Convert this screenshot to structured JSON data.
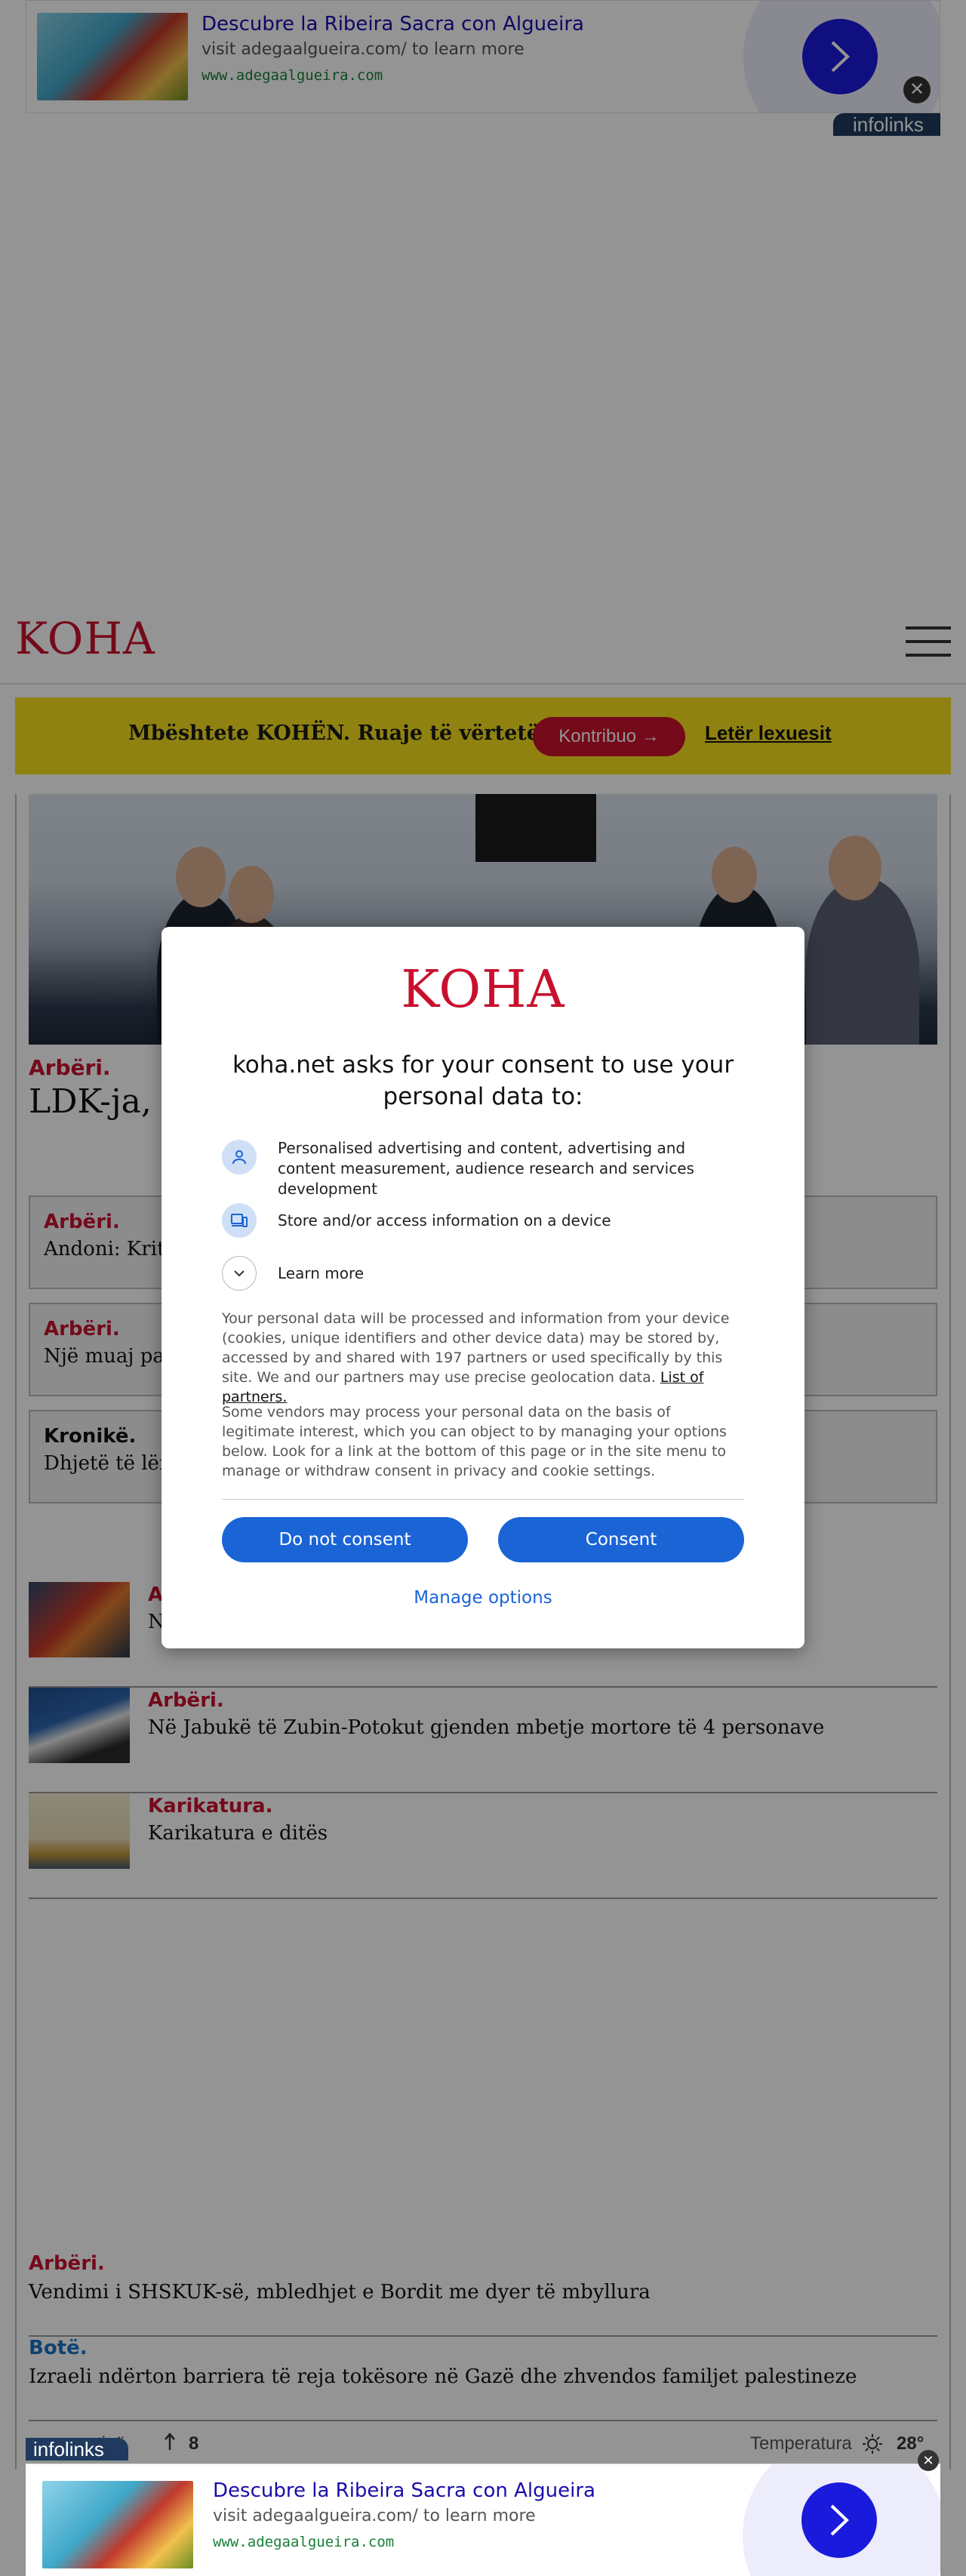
{
  "ads": {
    "top": {
      "title": "Descubre la Ribeira Sacra con Algueira",
      "line": "visit adegaalgueira.com/ to learn more",
      "url": "www.adegaalgueira.com",
      "badge": "infolinks"
    },
    "bottom": {
      "title": "Descubre la Ribeira Sacra con Algueira",
      "line": "visit adegaalgueira.com/ to learn more",
      "url": "www.adegaalgueira.com",
      "badge": "infolinks"
    },
    "close_glyph": "✕"
  },
  "header": {
    "logo": "KOHA",
    "menu_icon": "hamburger-menu-icon"
  },
  "support_bar": {
    "text": "Mbështete KOHËN. Ruaje të vërtetën",
    "button": "Kontribuo →",
    "link": "Letër lexuesit"
  },
  "lead": {
    "category": "Arbëri.",
    "headline": "LDK-ja, e"
  },
  "boxed": [
    {
      "category": "Arbëri.",
      "headline": "Andoni: Kritik"
    },
    {
      "category": "Arbëri.",
      "headline": "Një muaj para"
    },
    {
      "category": "Kronikë.",
      "headline": "Dhjetë të lënd"
    }
  ],
  "list": [
    {
      "category": "A",
      "headline": "N",
      "thumb": "fuel-pump-photo"
    },
    {
      "category": "Arbëri.",
      "headline": "Në Jabukë të Zubin-Potokut gjenden mbetje mortore të 4 personave",
      "thumb": "press-conference-photo"
    },
    {
      "category": "Karikatura.",
      "headline": "Karikatura e ditës",
      "thumb": "cartoon-thumb"
    }
  ],
  "plain": [
    {
      "category": "Arbëri.",
      "headline": "Vendimi i SHSKUK-së, mbledhjet e Bordit me dyer të mbyllura"
    },
    {
      "category": "Botë.",
      "headline": "Izraeli ndërton barriera të reja tokësore në Gazë dhe zhvendos familjet palestineze"
    }
  ],
  "footer": {
    "left_label": "tinë",
    "count": "8",
    "temp_label": "Temperatura",
    "temp_value": "28°"
  },
  "consent": {
    "logo": "KOHA",
    "heading": "koha.net asks for your consent to use your personal data to:",
    "purposes": [
      {
        "icon": "person-icon",
        "text": "Personalised advertising and content, advertising and content measurement, audience research and services development"
      },
      {
        "icon": "device-icon",
        "text": "Store and/or access information on a device"
      }
    ],
    "learn_more": "Learn more",
    "para1": "Your personal data will be processed and information from your device (cookies, unique identifiers and other device data) may be stored by, accessed by and shared with 197 partners or used specifically by this site. We and our partners may use precise geolocation data.",
    "partners_link": "List of partners.",
    "para2": "Some vendors may process your personal data on the basis of legitimate interest, which you can object to by managing your options below. Look for a link at the bottom of this page or in the site menu to manage or withdraw consent in privacy and cookie settings.",
    "btn_decline": "Do not consent",
    "btn_accept": "Consent",
    "manage": "Manage options"
  },
  "colors": {
    "brand_red": "#c8102e",
    "support_yellow": "#f7e11c",
    "consent_blue": "#1a64d6",
    "ad_blue": "#1a1adc"
  }
}
